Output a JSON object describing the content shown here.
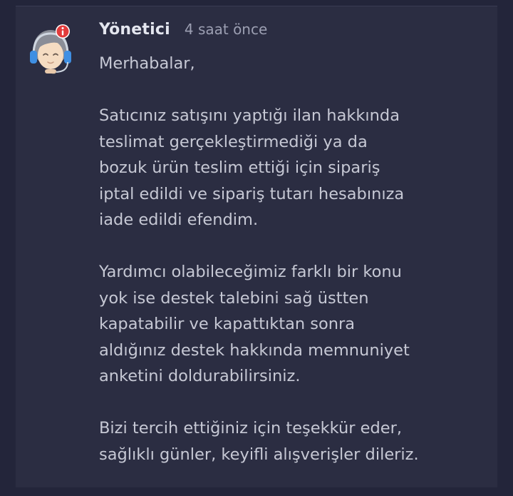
{
  "message": {
    "author": "Yönetici",
    "time": "4 saat önce",
    "avatar_icon": "support-agent-icon",
    "badge_icon": "info-badge-icon",
    "paragraphs": [
      "Merhabalar,",
      "Satıcınız satışını yaptığı ilan hakkında\nteslimat gerçekleştirmediği ya da\nbozuk ürün teslim ettiği için sipariş\niptal edildi ve sipariş tutarı hesabınıza\niade edildi efendim.",
      "Yardımcı olabileceğimiz farklı bir konu\nyok ise destek talebini sağ üstten\nkapatabilir ve kapattıktan sonra\naldığınız destek hakkında memnuniyet\nanketini doldurabilirsiniz.",
      "Bizi tercih ettiğiniz için teşekkür eder,\nsağlıklı günler, keyifli alışverişler dileriz."
    ]
  },
  "colors": {
    "page_background": "#23253a",
    "card_background": "#2b2d42",
    "author_text": "#e4e6ef",
    "time_text": "#9c9fb2",
    "body_text": "#c6c8d4",
    "headset_blue": "#3f8fe3",
    "badge_red": "#e23c3c"
  }
}
